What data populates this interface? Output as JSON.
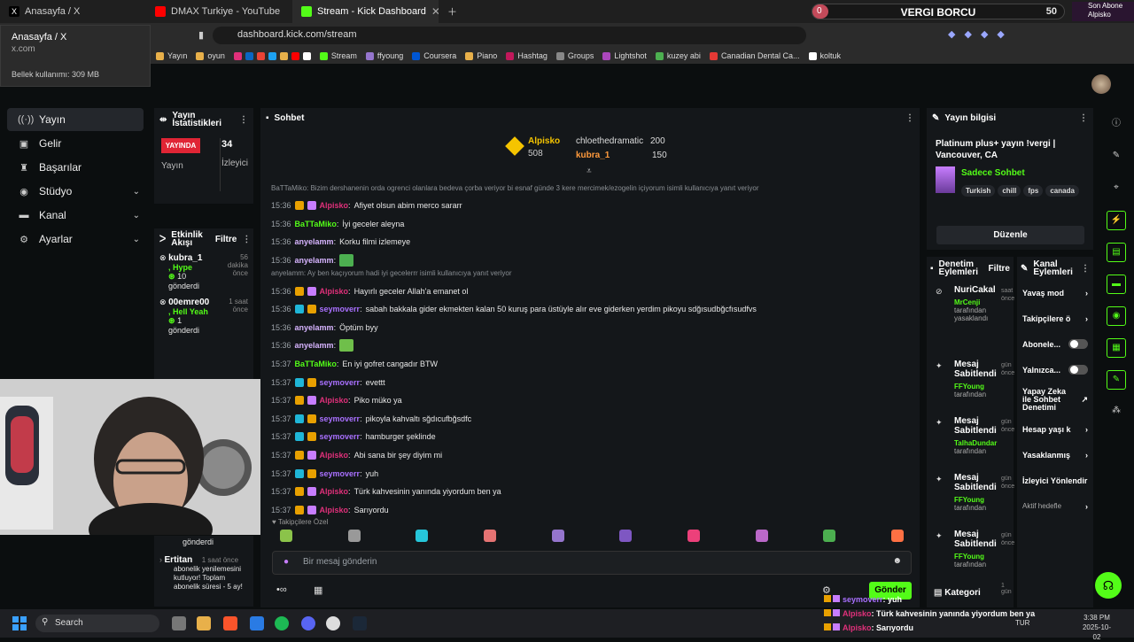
{
  "browser": {
    "tabs": [
      {
        "title": "Anasayfa / X",
        "color": "#000000",
        "icon": "x-logo-icon"
      },
      {
        "title": "DMAX Turkiye - YouTube",
        "color": "#ff0000",
        "icon": "youtube-icon"
      },
      {
        "title": "Stream - Kick Dashboard",
        "color": "#53fc18",
        "icon": "kick-icon"
      }
    ],
    "url": "dashboard.kick.com/stream",
    "bookmarks": [
      "Yayın",
      "oyun",
      "Stream",
      "ffyoung",
      "Coursera",
      "Piano",
      "Hashtag",
      "Groups",
      "Lightshot",
      "kuzey abi",
      "Canadian Dental Ca...",
      "koltuk"
    ],
    "tooltip": {
      "title": "Anasayfa / X",
      "domain": "x.com",
      "memory": "Bellek kullanımı: 309 MB"
    }
  },
  "vergi": {
    "left": "0",
    "label": "VERGI BORCU",
    "right": "50",
    "progress_fraction": 0.0
  },
  "son_abone": {
    "title": "Son Abone",
    "name": "Alpisko"
  },
  "nav": {
    "items": [
      {
        "label": "Yayın",
        "icon": "broadcast-icon",
        "chev": false,
        "active": true
      },
      {
        "label": "Gelir",
        "icon": "money-icon",
        "chev": false
      },
      {
        "label": "Başarılar",
        "icon": "trophy-icon",
        "chev": false
      },
      {
        "label": "Stüdyo",
        "icon": "studio-icon",
        "chev": true
      },
      {
        "label": "Kanal",
        "icon": "channel-icon",
        "chev": true
      },
      {
        "label": "Ayarlar",
        "icon": "gear-icon",
        "chev": true
      }
    ]
  },
  "stats": {
    "title": "Yayın İstatistikleri",
    "live": "YAYINDA",
    "live_label": "Yayın",
    "viewers": "34",
    "viewers_label": "İzleyici"
  },
  "events": {
    "title": "Etkinlik Akışı",
    "filter": "Filtre",
    "items": [
      {
        "name": "kubra_1",
        "time": "56 dakika önce",
        "type": "Hype",
        "count": "10",
        "sent": "gönderdi"
      },
      {
        "name": "00emre00",
        "time": "1 saat önce",
        "type": "Hell Yeah",
        "count": "1",
        "sent": "gönderdi"
      }
    ],
    "lower": {
      "sent": "gönderdi",
      "name": "Ertitan",
      "time": "1 saat önce",
      "text": "abonelik yenilemesini kutluyor! Toplam abonelik süresi - 5 ay!"
    }
  },
  "chat": {
    "title": "Sohbet",
    "pinned": [
      {
        "name": "Alpisko",
        "value": "508"
      },
      {
        "name": "chloethedramatic",
        "value": "200"
      },
      {
        "name": "kubra_1",
        "value": "150"
      }
    ],
    "messages": [
      {
        "reply": "BaTTaMiko: Bizim dershanenin orda ogrenci olanlara bedeva çorba veriyor bi esnaf günde 3 kere mercimek/ezogelin içiyorum isimli kullanıcıya yanıt veriyor"
      },
      {
        "time": "15:36",
        "user": "Alpisko",
        "color": "#e0307a",
        "badges": [
          "#e8a000",
          "#c77dff"
        ],
        "text": "Afiyet olsun abim merco sararr"
      },
      {
        "time": "15:36",
        "user": "BaTTaMiko",
        "color": "#53fc18",
        "badges": [],
        "text": "İyi geceler aleyna"
      },
      {
        "time": "15:36",
        "user": "anyelamm",
        "color": "#d7b4ff",
        "badges": [],
        "text": "Korku filmi izlemeye"
      },
      {
        "time": "15:36",
        "user": "anyelamm",
        "color": "#d7b4ff",
        "badges": [],
        "text": "",
        "emote": "#4caf50"
      },
      {
        "reply": "anyelamm: Ay ben kaçıyorum hadi iyi gecelerrr isimli kullanıcıya yanıt veriyor"
      },
      {
        "time": "15:36",
        "user": "Alpisko",
        "color": "#e0307a",
        "badges": [
          "#e8a000",
          "#c77dff"
        ],
        "text": "Hayırlı geceler Allah'a emanet ol"
      },
      {
        "time": "15:36",
        "user": "seymoverr",
        "color": "#a970ff",
        "badges": [
          "#1fb6d8",
          "#e8a000"
        ],
        "text": "sabah bakkala gider ekmekten kalan 50 kuruş para üstüyle alır eve giderken yerdim pikoyu sdğısudbğcfısudfvs"
      },
      {
        "time": "15:36",
        "user": "anyelamm",
        "color": "#d7b4ff",
        "badges": [],
        "text": "Öptüm byy"
      },
      {
        "time": "15:36",
        "user": "anyelamm",
        "color": "#d7b4ff",
        "badges": [],
        "text": "",
        "emote": "#6fbf4a"
      },
      {
        "time": "15:37",
        "user": "BaTTaMiko",
        "color": "#53fc18",
        "badges": [],
        "text": "En iyi gofret cangadır BTW"
      },
      {
        "time": "15:37",
        "user": "seymoverr",
        "color": "#a970ff",
        "badges": [
          "#1fb6d8",
          "#e8a000"
        ],
        "text": "evettt"
      },
      {
        "time": "15:37",
        "user": "Alpisko",
        "color": "#e0307a",
        "badges": [
          "#e8a000",
          "#c77dff"
        ],
        "text": "Piko müko ya"
      },
      {
        "time": "15:37",
        "user": "seymoverr",
        "color": "#a970ff",
        "badges": [
          "#1fb6d8",
          "#e8a000"
        ],
        "text": "pikoyla kahvaltı sğdıcufbğsdfc"
      },
      {
        "time": "15:37",
        "user": "seymoverr",
        "color": "#a970ff",
        "badges": [
          "#1fb6d8",
          "#e8a000"
        ],
        "text": "hamburger şeklinde"
      },
      {
        "time": "15:37",
        "user": "Alpisko",
        "color": "#e0307a",
        "badges": [
          "#e8a000",
          "#c77dff"
        ],
        "text": "Abi sana bir şey diyim mi"
      },
      {
        "time": "15:37",
        "user": "seymoverr",
        "color": "#a970ff",
        "badges": [
          "#1fb6d8",
          "#e8a000"
        ],
        "text": "yuh"
      },
      {
        "time": "15:37",
        "user": "Alpisko",
        "color": "#e0307a",
        "badges": [
          "#e8a000",
          "#c77dff"
        ],
        "text": "Türk kahvesinin yanında yiyordum ben ya"
      },
      {
        "time": "15:37",
        "user": "Alpisko",
        "color": "#e0307a",
        "badges": [
          "#e8a000",
          "#c77dff"
        ],
        "text": "Sarıyordu"
      }
    ],
    "followers_only": "Takipçilere Özel",
    "emotes": [
      "#8bc34a",
      "#999999",
      "#26c6da",
      "#e57373",
      "#9575cd",
      "#7e57c2",
      "#ec407a",
      "#ba68c8",
      "#4caf50",
      "#ff7043"
    ],
    "input_placeholder": "Bir mesaj gönderin",
    "send": "Gönder"
  },
  "info": {
    "title": "Yayın bilgisi",
    "stream_title": "Platinum plus+ yayın !vergi | Vancouver, CA",
    "category": "Sadece Sohbet",
    "tags": [
      "Turkish",
      "chill",
      "fps",
      "canada"
    ],
    "edit": "Düzenle"
  },
  "audit": {
    "title": "Denetim Eylemleri",
    "filter": "Filtre",
    "items": [
      {
        "icon": "ban-icon",
        "action": "NuriCakal",
        "time": "saat önce",
        "by": "MrCenji",
        "by_label": "tarafından yasaklandı"
      },
      {
        "icon": "pin-icon",
        "action": "Mesaj Sabitlendi",
        "time": "gün önce",
        "by": "FFYoung",
        "by_label": "tarafından"
      },
      {
        "icon": "pin-icon",
        "action": "Mesaj Sabitlendi",
        "time": "gün önce",
        "by": "TalhaDundar",
        "by_label": "tarafından"
      },
      {
        "icon": "pin-icon",
        "action": "Mesaj Sabitlendi",
        "time": "gün önce",
        "by": "FFYoung",
        "by_label": "tarafından"
      },
      {
        "icon": "pin-icon",
        "action": "Mesaj Sabitlendi",
        "time": "gün önce",
        "by": "FFYoung",
        "by_label": "tarafından"
      }
    ],
    "footer": "Kategori",
    "footer_time": "1 gün"
  },
  "channel": {
    "title": "Kanal Eylemleri",
    "items": [
      {
        "label": "Yavaş mod",
        "kind": "chev"
      },
      {
        "label": "Takipçilere ö",
        "kind": "chev"
      },
      {
        "label": "Abonele...",
        "kind": "toggle"
      },
      {
        "label": "Yalnızca...",
        "kind": "toggle"
      },
      {
        "label": "Yapay Zeka ile Sohbet Denetimi",
        "kind": "ext"
      },
      {
        "label": "Hesap yaşı k",
        "kind": "chev"
      },
      {
        "label": "Yasaklanmış",
        "kind": "chev"
      },
      {
        "label": "İzleyici Yönlendir",
        "kind": "none"
      },
      {
        "label": "Aktif hedefle",
        "kind": "chev"
      }
    ]
  },
  "overlay": [
    {
      "user": "seymoverr",
      "text": ": yuh",
      "color": "#a970ff"
    },
    {
      "user": "Alpisko",
      "text": ": Türk kahvesinin yanında yiyordum ben ya",
      "color": "#e0307a"
    },
    {
      "user": "Alpisko",
      "text": ": Sarıyordu",
      "color": "#e0307a"
    }
  ],
  "taskbar": {
    "search": "Search",
    "lang": "TUR",
    "time": "3:38 PM",
    "date": "2025-10-02"
  }
}
